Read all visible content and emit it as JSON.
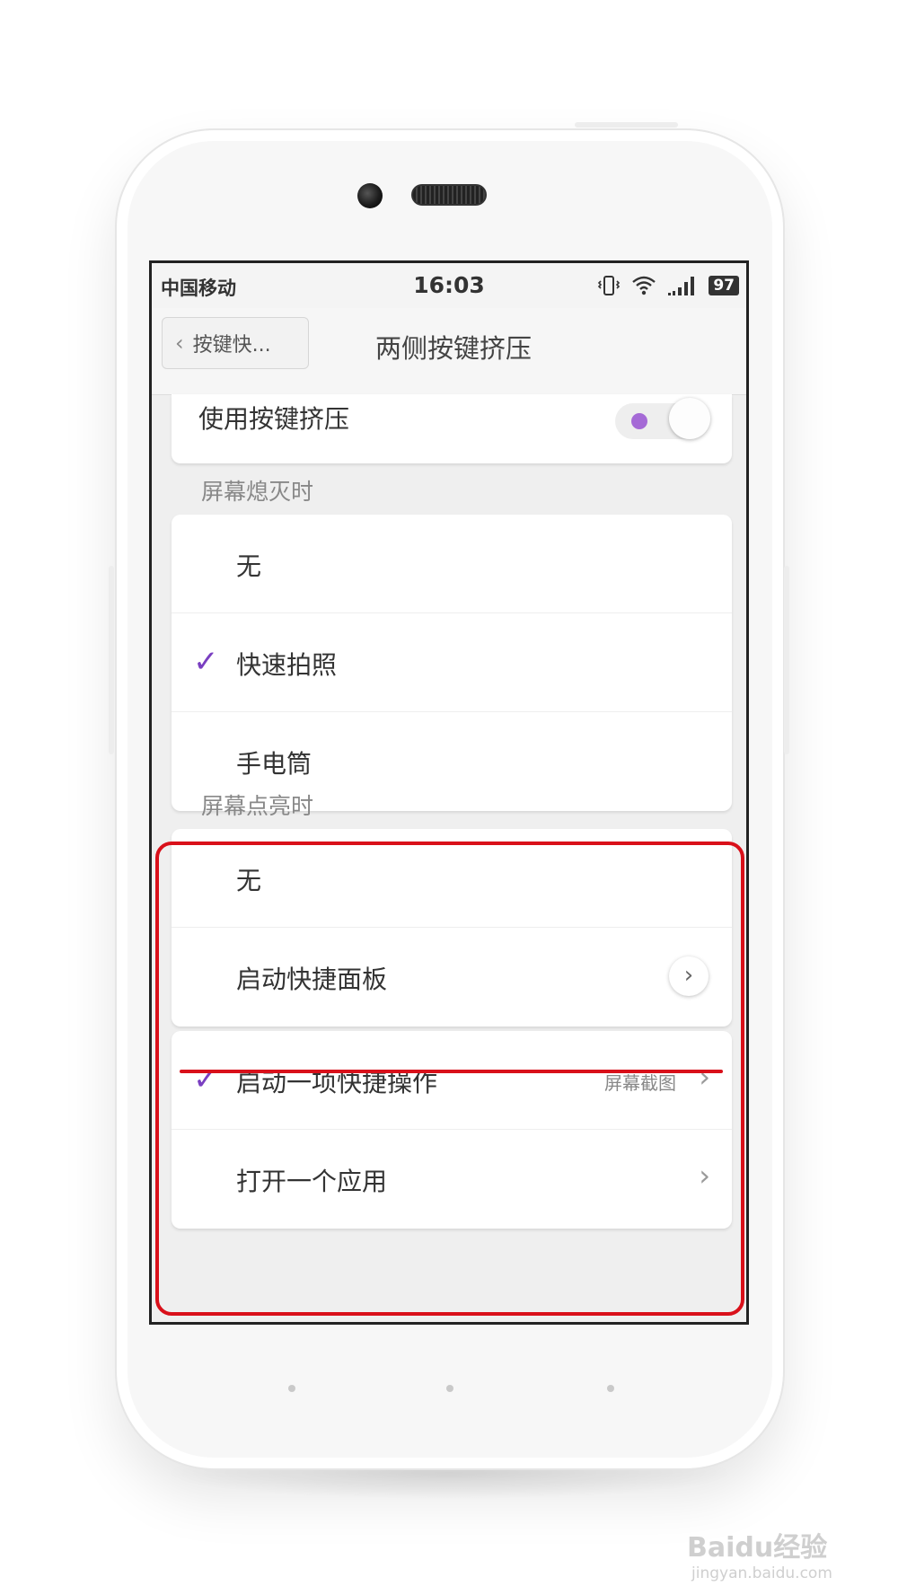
{
  "status_bar": {
    "carrier": "中国移动",
    "time": "16:03",
    "battery": "97"
  },
  "title_bar": {
    "back_label": "按键快...",
    "title": "两侧按键挤压"
  },
  "use_squeeze": {
    "label": "使用按键挤压",
    "enabled": true
  },
  "section_screen_off": {
    "header": "屏幕熄灭时",
    "options": [
      {
        "label": "无",
        "selected": false
      },
      {
        "label": "快速拍照",
        "selected": true
      },
      {
        "label": "手电筒",
        "selected": false
      }
    ]
  },
  "section_screen_on": {
    "header": "屏幕点亮时",
    "options": [
      {
        "label": "无",
        "selected": false
      },
      {
        "label": "启动快捷面板",
        "selected": false
      }
    ],
    "more_options": [
      {
        "label": "启动一项快捷操作",
        "selected": true,
        "value": "屏幕截图"
      },
      {
        "label": "打开一个应用",
        "selected": false
      }
    ]
  },
  "watermark": {
    "brand": "Baidu经验",
    "url": "jingyan.baidu.com"
  },
  "colors": {
    "accent": "#7a3fc1",
    "annotation": "#d9101a"
  }
}
